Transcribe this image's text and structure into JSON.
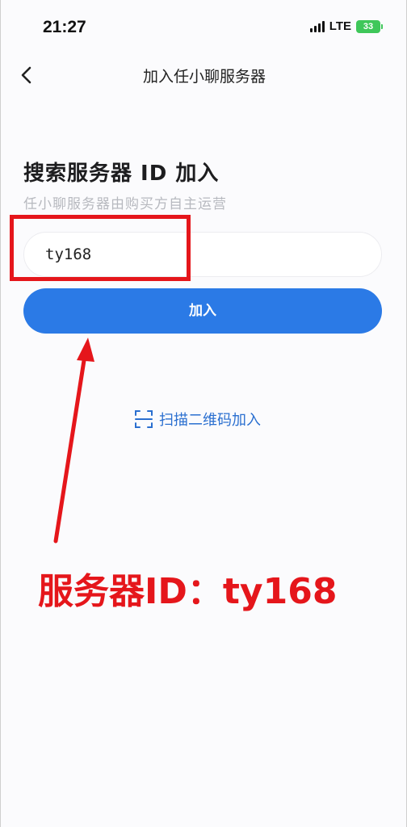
{
  "status_bar": {
    "time": "21:27",
    "network": "LTE",
    "battery": "33"
  },
  "nav": {
    "back_icon": "chevron-left-icon",
    "title": "加入任小聊服务器"
  },
  "main": {
    "heading": "搜索服务器 ID 加入",
    "subheading": "任小聊服务器由购买方自主运营",
    "server_id_input": {
      "value": "ty168",
      "placeholder": ""
    },
    "join_button_label": "加入",
    "scan_icon": "qr-scan-icon",
    "scan_label": "扫描二维码加入"
  },
  "annotation": {
    "text": "服务器ID：ty168",
    "color": "#e5161b"
  },
  "colors": {
    "accent": "#2b7ae6",
    "link": "#2a6fd0",
    "battery": "#3fc75a"
  }
}
